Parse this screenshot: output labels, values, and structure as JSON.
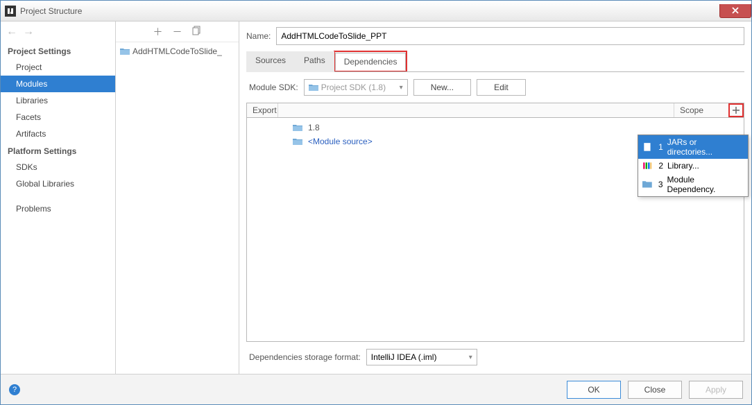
{
  "window": {
    "title": "Project Structure"
  },
  "sidebar": {
    "section1": "Project Settings",
    "items1": [
      "Project",
      "Modules",
      "Libraries",
      "Facets",
      "Artifacts"
    ],
    "section2": "Platform Settings",
    "items2": [
      "SDKs",
      "Global Libraries"
    ],
    "items3": [
      "Problems"
    ],
    "selected": "Modules"
  },
  "tree": {
    "module": "AddHTMLCodeToSlide_"
  },
  "main": {
    "name_label": "Name:",
    "name_value": "AddHTMLCodeToSlide_PPT",
    "tabs": [
      "Sources",
      "Paths",
      "Dependencies"
    ],
    "active_tab": "Dependencies",
    "sdk_label": "Module SDK:",
    "sdk_value": "Project SDK (1.8)",
    "new_btn": "New...",
    "edit_btn": "Edit",
    "table": {
      "export": "Export",
      "scope": "Scope"
    },
    "deps": [
      {
        "text": "1.8",
        "style": "normal"
      },
      {
        "text": "<Module source>",
        "style": "blue"
      }
    ],
    "storage_label": "Dependencies storage format:",
    "storage_value": "IntelliJ IDEA (.iml)"
  },
  "popup": {
    "items": [
      {
        "n": "1",
        "label": "JARs or directories...",
        "icon": "jar"
      },
      {
        "n": "2",
        "label": "Library...",
        "icon": "lib"
      },
      {
        "n": "3",
        "label": "Module Dependency.",
        "icon": "mod"
      }
    ]
  },
  "footer": {
    "ok": "OK",
    "cancel": "Close",
    "apply": "Apply"
  }
}
